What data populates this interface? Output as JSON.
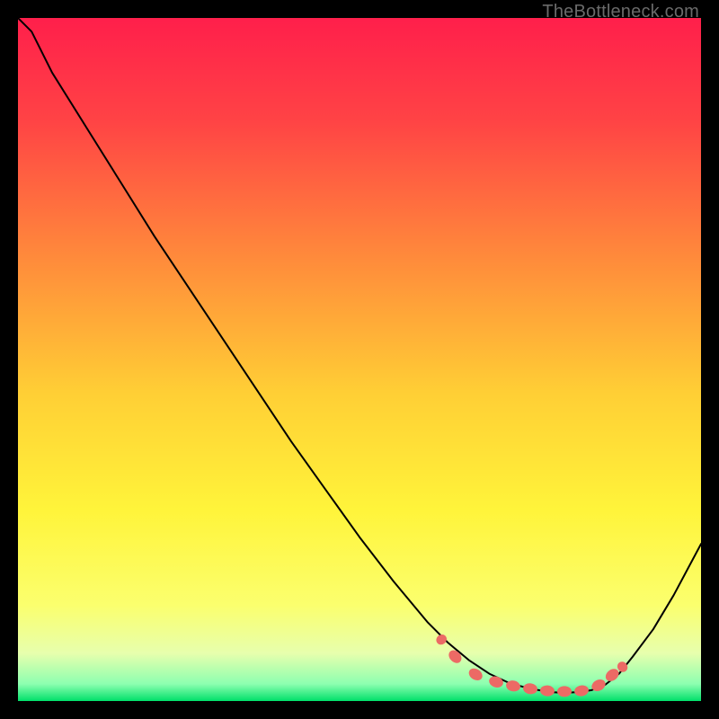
{
  "watermark": "TheBottleneck.com",
  "chart_data": {
    "type": "line",
    "title": "",
    "xlabel": "",
    "ylabel": "",
    "xlim": [
      0,
      100
    ],
    "ylim": [
      0,
      100
    ],
    "grid": false,
    "legend": false,
    "background_gradient": {
      "stops": [
        {
          "offset": 0.0,
          "color": "#ff1f4b"
        },
        {
          "offset": 0.15,
          "color": "#ff4345"
        },
        {
          "offset": 0.35,
          "color": "#ff8a3b"
        },
        {
          "offset": 0.55,
          "color": "#ffcf35"
        },
        {
          "offset": 0.72,
          "color": "#fff43a"
        },
        {
          "offset": 0.86,
          "color": "#fbff6e"
        },
        {
          "offset": 0.93,
          "color": "#e7ffad"
        },
        {
          "offset": 0.975,
          "color": "#8dffb0"
        },
        {
          "offset": 1.0,
          "color": "#00e06a"
        }
      ]
    },
    "series": [
      {
        "name": "bottleneck-curve",
        "color": "#000000",
        "stroke_width": 2,
        "x": [
          0.0,
          2.0,
          5.0,
          10.0,
          15.0,
          20.0,
          25.0,
          30.0,
          35.0,
          40.0,
          45.0,
          50.0,
          55.0,
          60.0,
          63.0,
          66.0,
          69.0,
          72.0,
          75.0,
          78.0,
          80.0,
          82.0,
          84.0,
          86.0,
          88.0,
          90.0,
          93.0,
          96.0,
          100.0
        ],
        "y": [
          100.0,
          98.0,
          92.0,
          84.0,
          76.0,
          68.0,
          60.5,
          53.0,
          45.5,
          38.0,
          31.0,
          24.0,
          17.5,
          11.5,
          8.5,
          6.0,
          4.0,
          2.6,
          1.8,
          1.3,
          1.2,
          1.3,
          1.6,
          2.4,
          4.0,
          6.5,
          10.5,
          15.5,
          23.0
        ]
      }
    ],
    "markers": {
      "name": "optimum-dots",
      "color": "#ec6a65",
      "radius_px": 6,
      "long_radius_px": 8,
      "x": [
        62.0,
        64.0,
        67.0,
        70.0,
        72.5,
        75.0,
        77.5,
        80.0,
        82.5,
        85.0,
        87.0,
        88.5
      ],
      "y": [
        9.0,
        6.5,
        3.9,
        2.8,
        2.2,
        1.8,
        1.5,
        1.4,
        1.5,
        2.3,
        3.8,
        5.0
      ]
    }
  }
}
